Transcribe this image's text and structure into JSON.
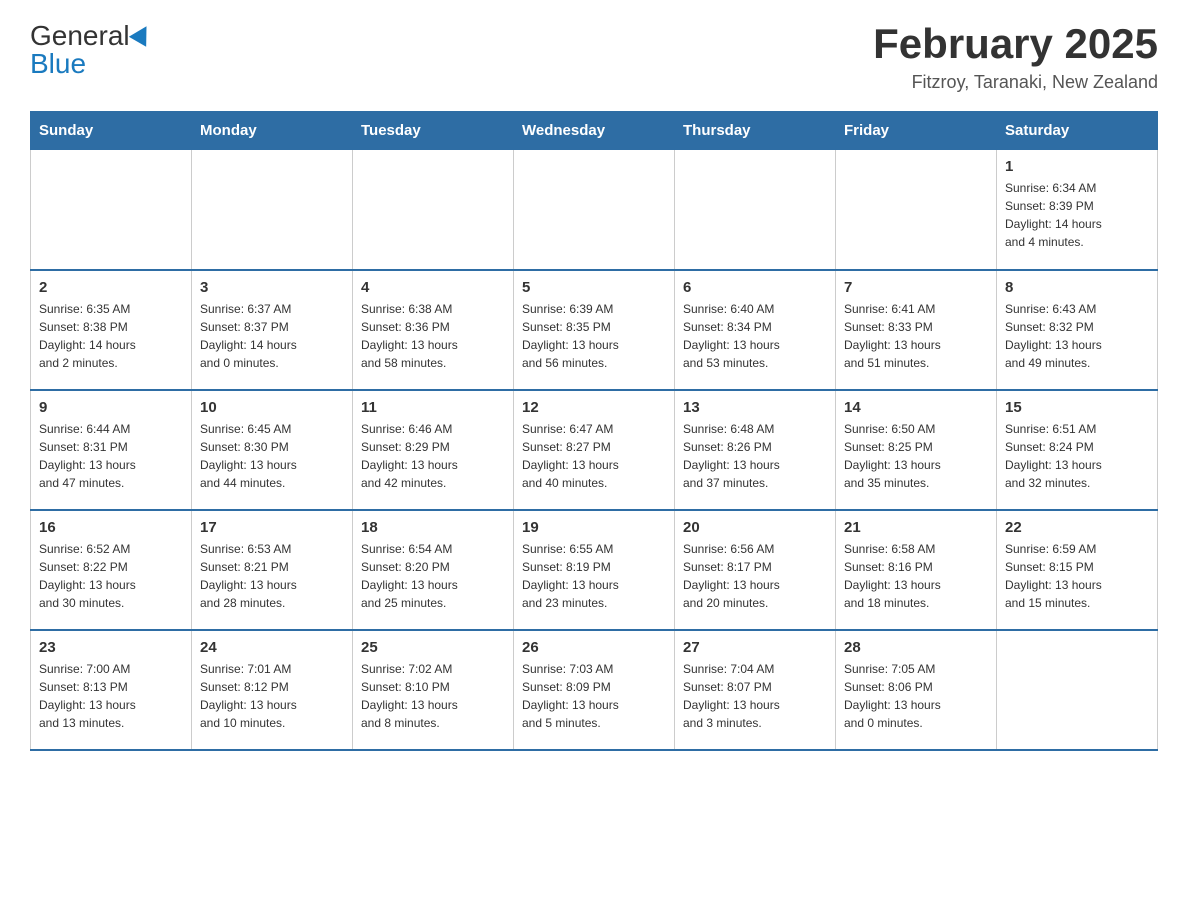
{
  "header": {
    "title": "February 2025",
    "location": "Fitzroy, Taranaki, New Zealand",
    "logo_general": "General",
    "logo_blue": "Blue"
  },
  "columns": [
    "Sunday",
    "Monday",
    "Tuesday",
    "Wednesday",
    "Thursday",
    "Friday",
    "Saturday"
  ],
  "weeks": [
    {
      "days": [
        {
          "num": "",
          "info": ""
        },
        {
          "num": "",
          "info": ""
        },
        {
          "num": "",
          "info": ""
        },
        {
          "num": "",
          "info": ""
        },
        {
          "num": "",
          "info": ""
        },
        {
          "num": "",
          "info": ""
        },
        {
          "num": "1",
          "info": "Sunrise: 6:34 AM\nSunset: 8:39 PM\nDaylight: 14 hours\nand 4 minutes."
        }
      ]
    },
    {
      "days": [
        {
          "num": "2",
          "info": "Sunrise: 6:35 AM\nSunset: 8:38 PM\nDaylight: 14 hours\nand 2 minutes."
        },
        {
          "num": "3",
          "info": "Sunrise: 6:37 AM\nSunset: 8:37 PM\nDaylight: 14 hours\nand 0 minutes."
        },
        {
          "num": "4",
          "info": "Sunrise: 6:38 AM\nSunset: 8:36 PM\nDaylight: 13 hours\nand 58 minutes."
        },
        {
          "num": "5",
          "info": "Sunrise: 6:39 AM\nSunset: 8:35 PM\nDaylight: 13 hours\nand 56 minutes."
        },
        {
          "num": "6",
          "info": "Sunrise: 6:40 AM\nSunset: 8:34 PM\nDaylight: 13 hours\nand 53 minutes."
        },
        {
          "num": "7",
          "info": "Sunrise: 6:41 AM\nSunset: 8:33 PM\nDaylight: 13 hours\nand 51 minutes."
        },
        {
          "num": "8",
          "info": "Sunrise: 6:43 AM\nSunset: 8:32 PM\nDaylight: 13 hours\nand 49 minutes."
        }
      ]
    },
    {
      "days": [
        {
          "num": "9",
          "info": "Sunrise: 6:44 AM\nSunset: 8:31 PM\nDaylight: 13 hours\nand 47 minutes."
        },
        {
          "num": "10",
          "info": "Sunrise: 6:45 AM\nSunset: 8:30 PM\nDaylight: 13 hours\nand 44 minutes."
        },
        {
          "num": "11",
          "info": "Sunrise: 6:46 AM\nSunset: 8:29 PM\nDaylight: 13 hours\nand 42 minutes."
        },
        {
          "num": "12",
          "info": "Sunrise: 6:47 AM\nSunset: 8:27 PM\nDaylight: 13 hours\nand 40 minutes."
        },
        {
          "num": "13",
          "info": "Sunrise: 6:48 AM\nSunset: 8:26 PM\nDaylight: 13 hours\nand 37 minutes."
        },
        {
          "num": "14",
          "info": "Sunrise: 6:50 AM\nSunset: 8:25 PM\nDaylight: 13 hours\nand 35 minutes."
        },
        {
          "num": "15",
          "info": "Sunrise: 6:51 AM\nSunset: 8:24 PM\nDaylight: 13 hours\nand 32 minutes."
        }
      ]
    },
    {
      "days": [
        {
          "num": "16",
          "info": "Sunrise: 6:52 AM\nSunset: 8:22 PM\nDaylight: 13 hours\nand 30 minutes."
        },
        {
          "num": "17",
          "info": "Sunrise: 6:53 AM\nSunset: 8:21 PM\nDaylight: 13 hours\nand 28 minutes."
        },
        {
          "num": "18",
          "info": "Sunrise: 6:54 AM\nSunset: 8:20 PM\nDaylight: 13 hours\nand 25 minutes."
        },
        {
          "num": "19",
          "info": "Sunrise: 6:55 AM\nSunset: 8:19 PM\nDaylight: 13 hours\nand 23 minutes."
        },
        {
          "num": "20",
          "info": "Sunrise: 6:56 AM\nSunset: 8:17 PM\nDaylight: 13 hours\nand 20 minutes."
        },
        {
          "num": "21",
          "info": "Sunrise: 6:58 AM\nSunset: 8:16 PM\nDaylight: 13 hours\nand 18 minutes."
        },
        {
          "num": "22",
          "info": "Sunrise: 6:59 AM\nSunset: 8:15 PM\nDaylight: 13 hours\nand 15 minutes."
        }
      ]
    },
    {
      "days": [
        {
          "num": "23",
          "info": "Sunrise: 7:00 AM\nSunset: 8:13 PM\nDaylight: 13 hours\nand 13 minutes."
        },
        {
          "num": "24",
          "info": "Sunrise: 7:01 AM\nSunset: 8:12 PM\nDaylight: 13 hours\nand 10 minutes."
        },
        {
          "num": "25",
          "info": "Sunrise: 7:02 AM\nSunset: 8:10 PM\nDaylight: 13 hours\nand 8 minutes."
        },
        {
          "num": "26",
          "info": "Sunrise: 7:03 AM\nSunset: 8:09 PM\nDaylight: 13 hours\nand 5 minutes."
        },
        {
          "num": "27",
          "info": "Sunrise: 7:04 AM\nSunset: 8:07 PM\nDaylight: 13 hours\nand 3 minutes."
        },
        {
          "num": "28",
          "info": "Sunrise: 7:05 AM\nSunset: 8:06 PM\nDaylight: 13 hours\nand 0 minutes."
        },
        {
          "num": "",
          "info": ""
        }
      ]
    }
  ]
}
